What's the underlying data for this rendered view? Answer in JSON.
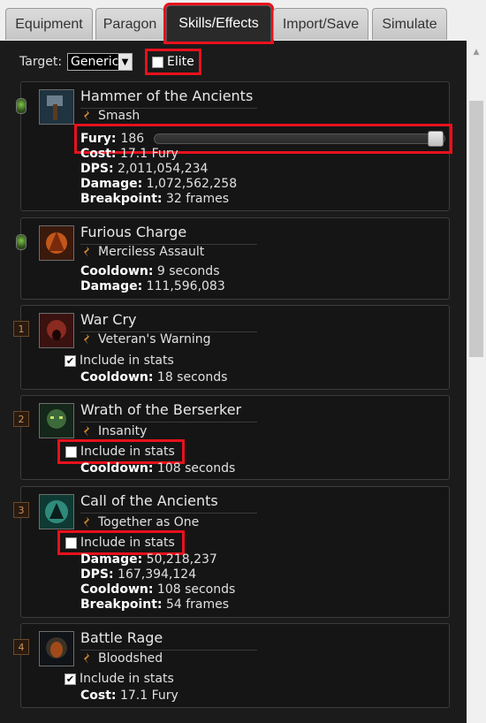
{
  "tabs": [
    {
      "label": "Equipment"
    },
    {
      "label": "Paragon"
    },
    {
      "label": "Skills/Effects"
    },
    {
      "label": "Import/Save"
    },
    {
      "label": "Simulate"
    }
  ],
  "controls": {
    "target_label": "Target:",
    "target_value": "Generic",
    "elite_label": "Elite"
  },
  "skills": [
    {
      "name": "Hammer of the Ancients",
      "rune": "Smash",
      "resource_label": "Fury:",
      "resource_value": "186",
      "resource_slider_fraction": 1.0,
      "stats": [
        {
          "label": "Cost:",
          "value": "17.1 Fury"
        },
        {
          "label": "DPS:",
          "value": "2,011,054,234"
        },
        {
          "label": "Damage:",
          "value": "1,072,562,258"
        },
        {
          "label": "Breakpoint:",
          "value": "32 frames"
        }
      ]
    },
    {
      "name": "Furious Charge",
      "rune": "Merciless Assault",
      "stats": [
        {
          "label": "Cooldown:",
          "value": "9 seconds"
        },
        {
          "label": "Damage:",
          "value": "111,596,083"
        }
      ]
    },
    {
      "rank": "1",
      "name": "War Cry",
      "rune": "Veteran's Warning",
      "include_label": "Include in stats",
      "include_checked": true,
      "stats": [
        {
          "label": "Cooldown:",
          "value": "18 seconds"
        }
      ]
    },
    {
      "rank": "2",
      "name": "Wrath of the Berserker",
      "rune": "Insanity",
      "include_label": "Include in stats",
      "include_checked": false,
      "stats": [
        {
          "label": "Cooldown:",
          "value": "108 seconds"
        }
      ]
    },
    {
      "rank": "3",
      "name": "Call of the Ancients",
      "rune": "Together as One",
      "include_label": "Include in stats",
      "include_checked": false,
      "stats": [
        {
          "label": "Damage:",
          "value": "50,218,237"
        },
        {
          "label": "DPS:",
          "value": "167,394,124"
        },
        {
          "label": "Cooldown:",
          "value": "108 seconds"
        },
        {
          "label": "Breakpoint:",
          "value": "54 frames"
        }
      ]
    },
    {
      "rank": "4",
      "name": "Battle Rage",
      "rune": "Bloodshed",
      "include_label": "Include in stats",
      "include_checked": true,
      "stats": [
        {
          "label": "Cost:",
          "value": "17.1 Fury"
        }
      ]
    }
  ],
  "icons": {
    "dropdown": "chevron-down-icon",
    "check": "check-icon",
    "passive_gem": "green-gem-icon",
    "rune": "rune-icon"
  },
  "colors": {
    "highlight": "#e8111c",
    "background": "#1b1b1b",
    "rank_text": "#c9955a"
  }
}
